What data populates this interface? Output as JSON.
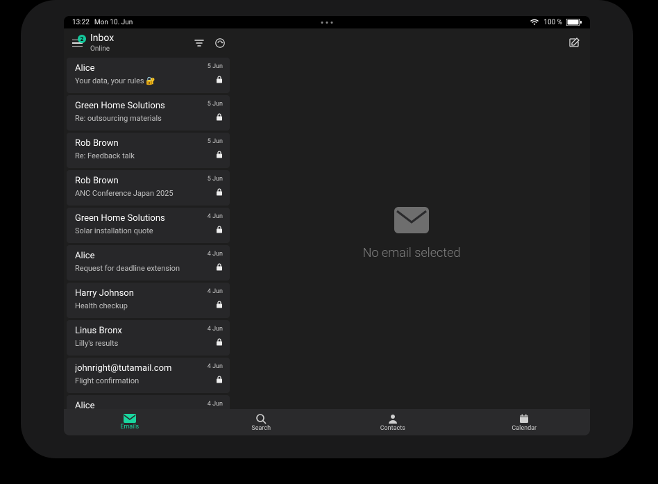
{
  "statusbar": {
    "time": "13:22",
    "date": "Mon 10. Jun",
    "battery": "100 %"
  },
  "header": {
    "badge": "2",
    "title": "Inbox",
    "status": "Online"
  },
  "detail": {
    "empty_text": "No email selected"
  },
  "nav": {
    "emails": "Emails",
    "search": "Search",
    "contacts": "Contacts",
    "calendar": "Calendar"
  },
  "messages": [
    {
      "from": "Alice",
      "subject": "Your data, your rules 🔐",
      "date": "5 Jun"
    },
    {
      "from": "Green Home Solutions",
      "subject": "Re: outsourcing materials",
      "date": "5 Jun"
    },
    {
      "from": "Rob Brown",
      "subject": "Re: Feedback talk",
      "date": "5 Jun"
    },
    {
      "from": "Rob Brown",
      "subject": "ANC Conference Japan 2025",
      "date": "5 Jun"
    },
    {
      "from": "Green Home Solutions",
      "subject": "Solar installation quote",
      "date": "4 Jun"
    },
    {
      "from": "Alice",
      "subject": "Request for deadline extension",
      "date": "4 Jun"
    },
    {
      "from": "Harry Johnson",
      "subject": "Health checkup",
      "date": "4 Jun"
    },
    {
      "from": "Linus Bronx",
      "subject": "Lilly's results",
      "date": "4 Jun"
    },
    {
      "from": "johnright@tutamail.com",
      "subject": "Flight confirmation",
      "date": "4 Jun"
    },
    {
      "from": "Alice",
      "subject": "",
      "date": "4 Jun"
    }
  ]
}
